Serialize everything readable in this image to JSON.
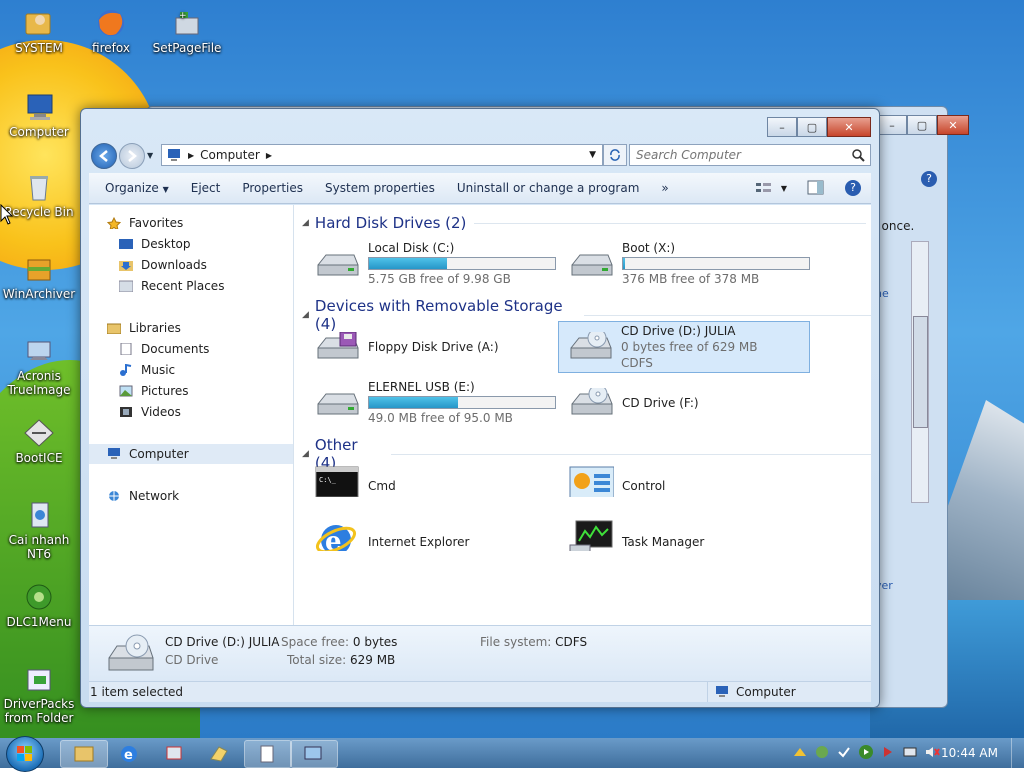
{
  "desktop_icons": [
    {
      "label": "SYSTEM",
      "icon": "folder-user-icon"
    },
    {
      "label": "firefox",
      "icon": "firefox-icon"
    },
    {
      "label": "SetPageFile",
      "icon": "setpagefile-icon"
    },
    {
      "label": "Computer",
      "icon": "computer-icon"
    },
    {
      "label": "Recycle Bin",
      "icon": "recycle-bin-icon"
    },
    {
      "label": "WinArchiver",
      "icon": "winarchiver-icon"
    },
    {
      "label": "Acronis TrueImage",
      "icon": "acronis-icon"
    },
    {
      "label": "BootICE",
      "icon": "bootice-icon"
    },
    {
      "label": "Cai nhanh NT6",
      "icon": "install-icon"
    },
    {
      "label": "DLC1Menu",
      "icon": "dlc-icon"
    },
    {
      "label": "DriverPacks from Folder",
      "icon": "driverpacks-icon"
    }
  ],
  "back_window": {
    "text1": "t once.",
    "text2": "ne",
    "text3": "ver"
  },
  "explorer": {
    "address": "Computer",
    "search_placeholder": "Search Computer",
    "toolbar": [
      "Organize",
      "Eject",
      "Properties",
      "System properties",
      "Uninstall or change a program"
    ],
    "toolbar_more": "»",
    "nav": {
      "favorites": "Favorites",
      "desktop": "Desktop",
      "downloads": "Downloads",
      "recent": "Recent Places",
      "libraries": "Libraries",
      "documents": "Documents",
      "music": "Music",
      "pictures": "Pictures",
      "videos": "Videos",
      "computer": "Computer",
      "network": "Network"
    },
    "groups": {
      "hdd": "Hard Disk Drives (2)",
      "removable": "Devices with Removable Storage (4)",
      "other": "Other (4)"
    },
    "items": {
      "c": {
        "name": "Local Disk (C:)",
        "free": "5.75 GB free of 9.98 GB",
        "used_fraction": 0.42
      },
      "x": {
        "name": "Boot (X:)",
        "free": "376 MB free of 378 MB",
        "used_fraction": 0.01
      },
      "a": {
        "name": "Floppy Disk Drive (A:)"
      },
      "d": {
        "name": "CD Drive (D:) JULIA",
        "free": "0 bytes free of 629 MB",
        "fs": "CDFS"
      },
      "e": {
        "name": "ELERNEL USB (E:)",
        "free": "49.0 MB free of 95.0 MB",
        "used_fraction": 0.48
      },
      "f": {
        "name": "CD Drive (F:)"
      },
      "cmd": {
        "name": "Cmd"
      },
      "control": {
        "name": "Control"
      },
      "ie": {
        "name": "Internet Explorer"
      },
      "taskmgr": {
        "name": "Task Manager"
      }
    },
    "details": {
      "name": "CD Drive (D:) JULIA",
      "type": "CD Drive",
      "space_free_label": "Space free:",
      "space_free": "0 bytes",
      "total_label": "Total size:",
      "total": "629 MB",
      "fs_label": "File system:",
      "fs": "CDFS"
    },
    "status": {
      "left": "1 item selected",
      "right": "Computer"
    }
  },
  "taskbar": {
    "clock": "10:44 AM"
  }
}
